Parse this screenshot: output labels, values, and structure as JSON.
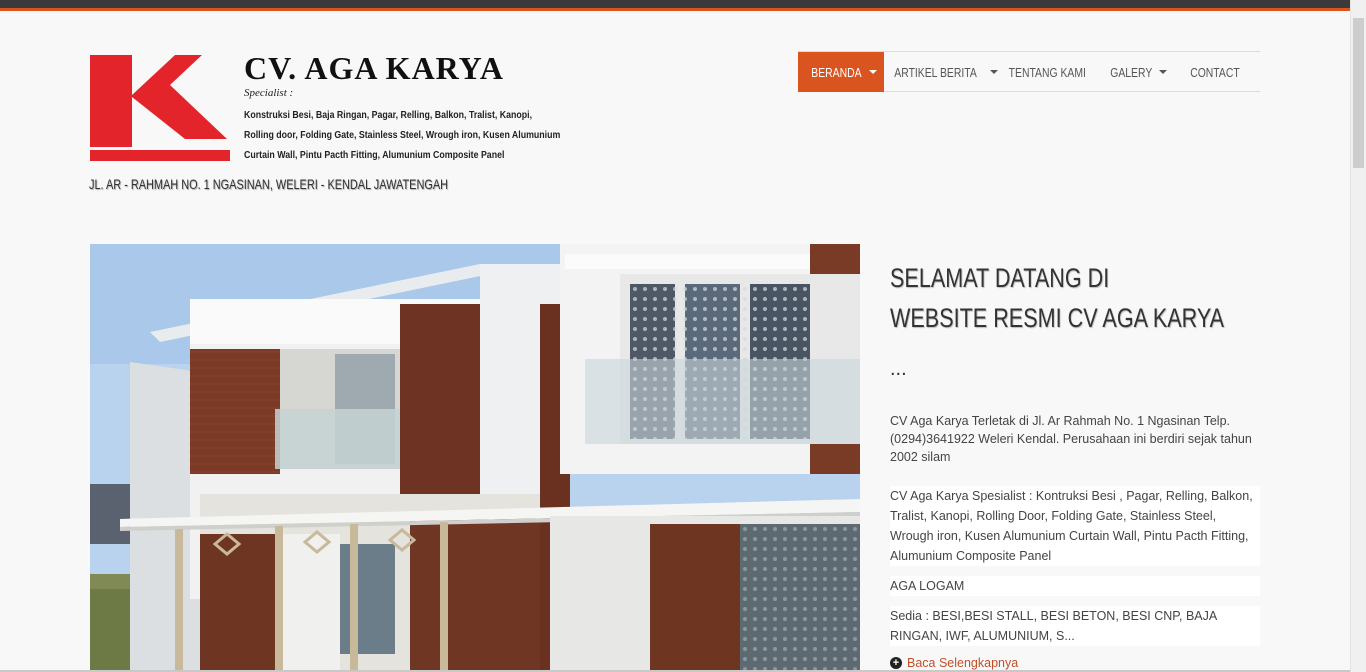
{
  "header": {
    "company_name": "CV. AGA KARYA",
    "specialist_label": "Specialist :",
    "specialist_lines": [
      "Konstruksi Besi, Baja Ringan, Pagar, Relling, Balkon, Tralist, Kanopi,",
      "Rolling door, Folding Gate, Stainless Steel, Wrough iron, Kusen Alumunium",
      "Curtain Wall, Pintu Pacth Fitting, Alumunium Composite Panel"
    ],
    "address": "JL. AR - RAHMAH NO. 1 NGASINAN, WELERI - KENDAL JAWATENGAH"
  },
  "nav": {
    "items": [
      {
        "label": "BERANDA",
        "has_dropdown": true,
        "active": true
      },
      {
        "label": "ARTIKEL BERITA",
        "has_dropdown": true,
        "active": false
      },
      {
        "label": "TENTANG KAMI",
        "has_dropdown": false,
        "active": false
      },
      {
        "label": "GALERY",
        "has_dropdown": true,
        "active": false
      },
      {
        "label": "CONTACT",
        "has_dropdown": false,
        "active": false
      }
    ]
  },
  "main": {
    "welcome_line1": "SELAMAT DATANG DI",
    "welcome_line2": "WEBSITE RESMI CV AGA KARYA",
    "ellipsis": "...",
    "paragraph1": "CV Aga Karya Terletak di Jl. Ar Rahmah No. 1 Ngasinan Telp. (0294)3641922 Weleri Kendal. Perusahaan ini berdiri sejak tahun 2002 silam",
    "paragraph2": "CV Aga Karya Spesialist : Kontruksi Besi , Pagar, Relling, Balkon, Tralist, Kanopi, Rolling Door, Folding Gate, Stainless Steel, Wrough iron, Kusen Alumunium Curtain Wall, Pintu Pacth Fitting, Alumunium Composite Panel",
    "paragraph3": "AGA LOGAM",
    "paragraph4": "Sedia : BESI,BESI STALL, BESI BETON, BESI CNP, BAJA RINGAN, IWF, ALUMUNIUM, S...",
    "read_more": "Baca Selengkapnya"
  },
  "colors": {
    "accent": "#d9541f",
    "logo_red": "#e3242b",
    "topbar": "#3a3a3a"
  }
}
